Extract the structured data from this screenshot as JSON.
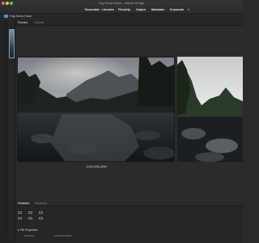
{
  "window": {
    "title": "Fog Snow Hose – Adobe Bridge",
    "traffic_colors": [
      "#ec6a5e",
      "#f4bf4f",
      "#61c554"
    ]
  },
  "workspaces": [
    {
      "label": "Essentials"
    },
    {
      "label": "Libraries"
    },
    {
      "label": "Filmstrip"
    },
    {
      "label": "Output"
    },
    {
      "label": "Metadata"
    },
    {
      "label": "Keywords"
    },
    {
      "label": "»"
    }
  ],
  "path": {
    "back_icon": "chevron-left-icon",
    "folder_icon": "folder-icon",
    "label": "Fog Snow Hose"
  },
  "preview_tabs": [
    {
      "label": "Preview",
      "active": true
    },
    {
      "label": "Content",
      "active": false
    }
  ],
  "preview": {
    "filename": "_DSC0336.ARW"
  },
  "metadata_panel": {
    "tabs": [
      {
        "label": "Metadata",
        "active": true
      },
      {
        "label": "Keywords",
        "active": false
      }
    ],
    "section": "File Properties",
    "rows": [
      {
        "label": "Filename",
        "value": "_DSC0336.ARW"
      }
    ]
  },
  "colors": {
    "accent": "#4a90d9",
    "selection": "#6da1d8"
  }
}
